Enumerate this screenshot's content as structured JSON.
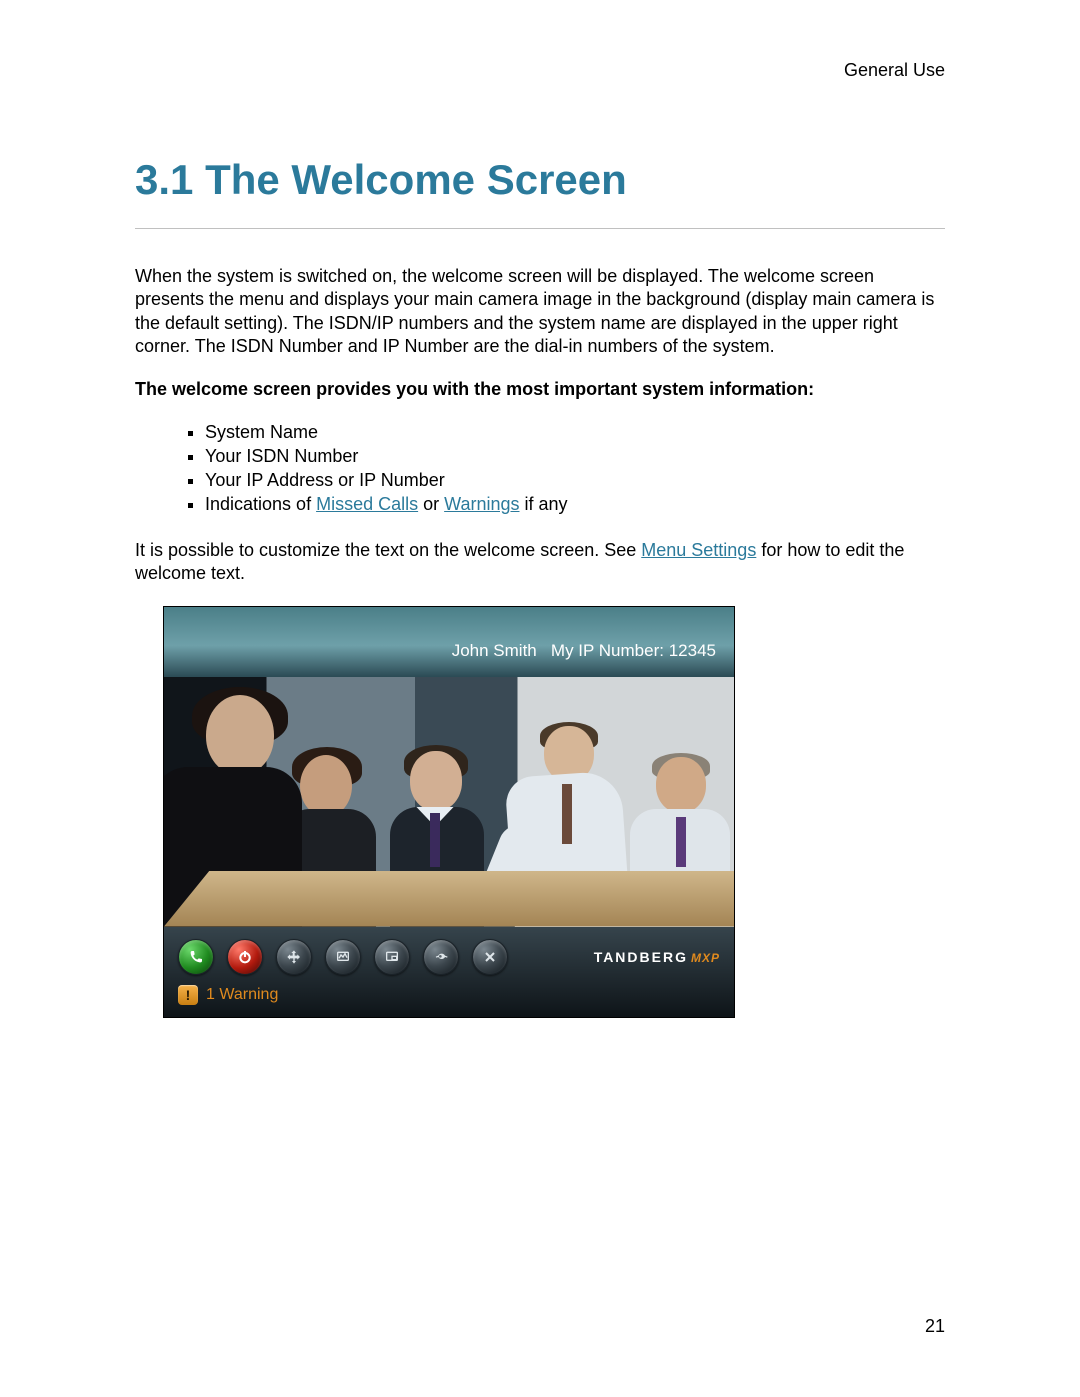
{
  "header": {
    "category": "General Use"
  },
  "section": {
    "number": "3.1",
    "title": "The Welcome Screen"
  },
  "paragraphs": {
    "intro": "When the system is switched on, the welcome screen will be displayed. The welcome screen presents the menu and displays your main camera image in the background (display main camera is the default setting). The ISDN/IP numbers and the system name are displayed in the upper right corner. The ISDN Number and IP Number are the dial-in numbers of the system.",
    "boldLine": "The welcome screen provides you with the most important system information:",
    "bullets": {
      "0": "System Name",
      "1": "Your ISDN Number",
      "2": "Your IP Address or IP Number",
      "3_prefix": "Indications of ",
      "3_link1": "Missed Calls",
      "3_mid": " or ",
      "3_link2": "Warnings",
      "3_suffix": " if any"
    },
    "customize_prefix": "It is possible to customize the text on the welcome screen. See ",
    "customize_link": "Menu Settings",
    "customize_suffix": " for how to edit the welcome text."
  },
  "screenshot": {
    "user_name": "John Smith",
    "ip_label": "My IP Number:",
    "ip_number": "12345",
    "brand": "TANDBERG",
    "brand_suffix": "MXP",
    "warning_count": "1",
    "warning_label": "Warning",
    "icons": {
      "call": "call-icon",
      "power": "power-icon",
      "move": "move-icon",
      "presentation": "presentation-icon",
      "layout": "layout-icon",
      "settings": "settings-icon",
      "close": "close-icon"
    }
  },
  "page_number": "21"
}
